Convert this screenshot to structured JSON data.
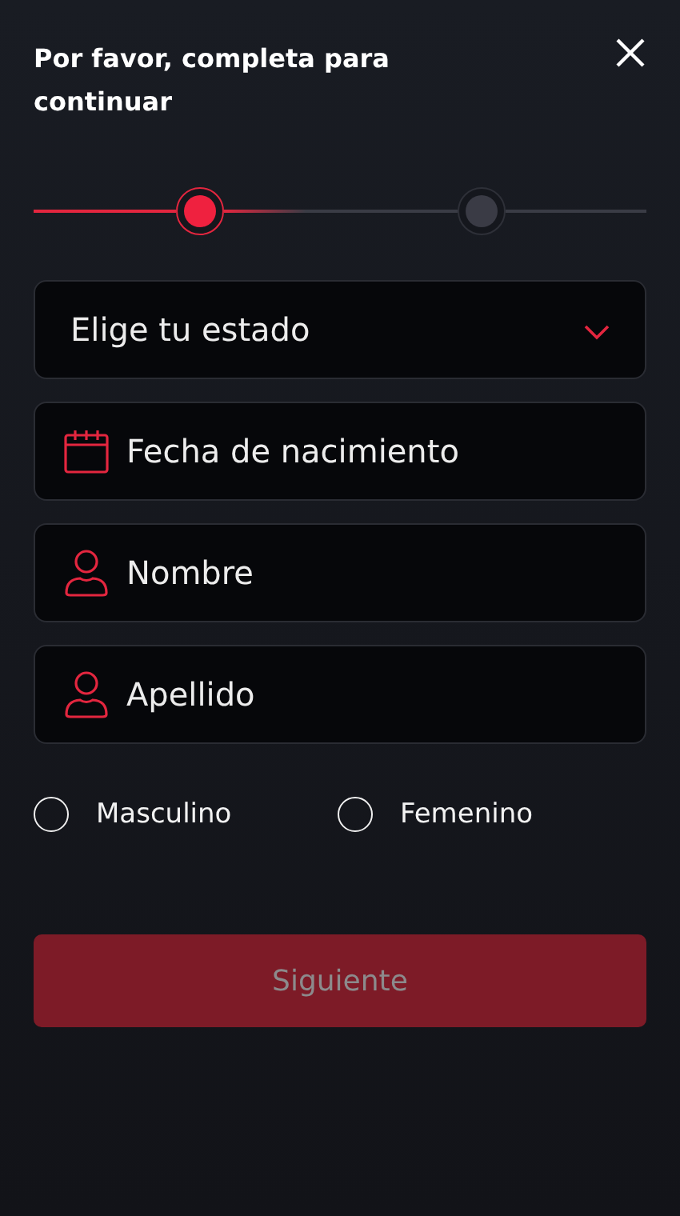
{
  "title": "Por favor, completa para continuar",
  "steps": [
    {
      "selected": true
    },
    {
      "selected": false
    }
  ],
  "fields": [
    {
      "kind": "select",
      "placeholder": "Elige tu estado"
    },
    {
      "kind": "date",
      "placeholder": "Fecha de nacimiento"
    },
    {
      "kind": "person",
      "placeholder": "Nombre"
    },
    {
      "kind": "person",
      "placeholder": "Apellido"
    }
  ],
  "gender": [
    {
      "label": "Masculino",
      "selected": false
    },
    {
      "label": "Femenino",
      "selected": false
    }
  ],
  "submit": {
    "label": "Siguiente",
    "disabled": true
  }
}
